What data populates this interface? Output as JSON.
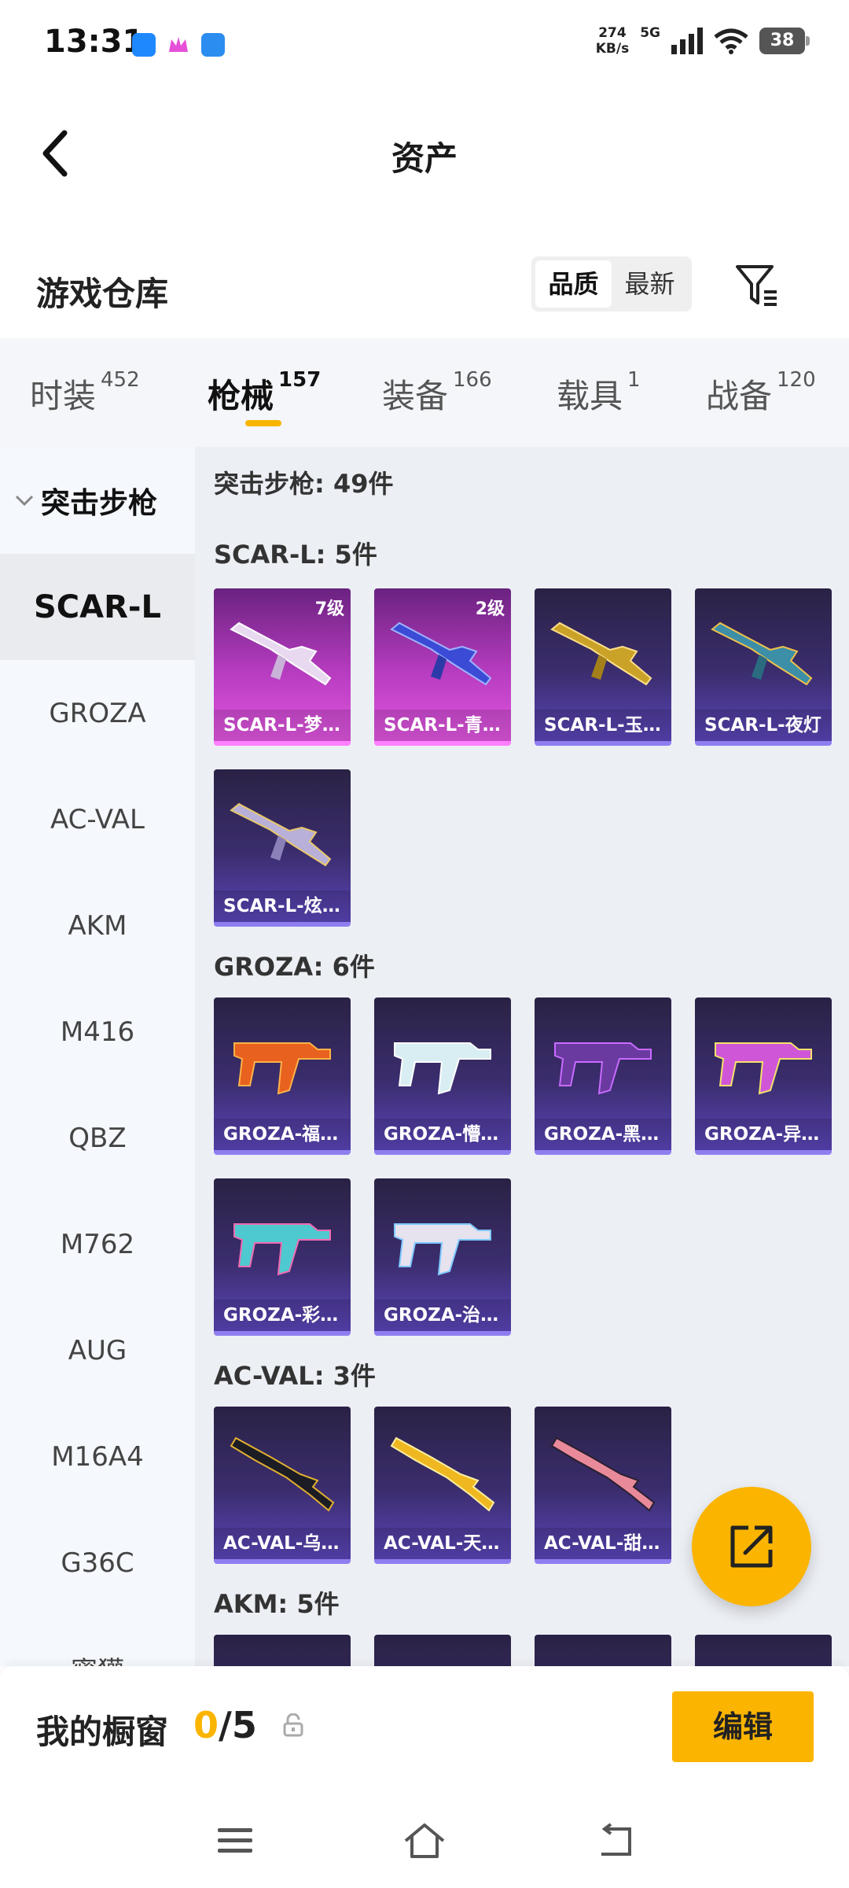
{
  "status_bar": {
    "time": "13:31",
    "net_speed_value": "274",
    "net_speed_unit": "KB/s",
    "network": "5G",
    "battery": "38"
  },
  "header": {
    "title": "资产"
  },
  "warehouse": {
    "title": "游戏仓库",
    "sort_options": [
      "品质",
      "最新"
    ],
    "sort_selected": "品质"
  },
  "tabs": [
    {
      "label": "时装",
      "count": "452"
    },
    {
      "label": "枪械",
      "count": "157"
    },
    {
      "label": "装备",
      "count": "166"
    },
    {
      "label": "载具",
      "count": "1"
    },
    {
      "label": "战备",
      "count": "120"
    }
  ],
  "sidebar": {
    "group": "突击步枪",
    "items": [
      "SCAR-L",
      "GROZA",
      "AC-VAL",
      "AKM",
      "M416",
      "QBZ",
      "M762",
      "AUG",
      "M16A4",
      "G36C",
      "蜜獾"
    ],
    "selected": "SCAR-L"
  },
  "content": {
    "heading": "突击步枪: 49件",
    "groups": [
      {
        "title": "SCAR-L: 5件",
        "items": [
          {
            "name": "SCAR-L-梦…",
            "level": "7级"
          },
          {
            "name": "SCAR-L-青…",
            "level": "2级"
          },
          {
            "name": "SCAR-L-玉…"
          },
          {
            "name": "SCAR-L-夜灯"
          },
          {
            "name": "SCAR-L-炫…"
          }
        ]
      },
      {
        "title": "GROZA: 6件",
        "items": [
          {
            "name": "GROZA-福…"
          },
          {
            "name": "GROZA-懵…"
          },
          {
            "name": "GROZA-黑…"
          },
          {
            "name": "GROZA-异…"
          },
          {
            "name": "GROZA-彩…"
          },
          {
            "name": "GROZA-治…"
          }
        ]
      },
      {
        "title": "AC-VAL: 3件",
        "items": [
          {
            "name": "AC-VAL-乌…"
          },
          {
            "name": "AC-VAL-天…"
          },
          {
            "name": "AC-VAL-甜…"
          }
        ]
      },
      {
        "title": "AKM: 5件"
      }
    ]
  },
  "bottom": {
    "window_label": "我的橱窗",
    "window_used": "0",
    "window_total": "/5",
    "edit_label": "编辑"
  },
  "colors": {
    "accent": "#fbb400",
    "card_purple": "#3b2d6e",
    "card_pink": "#b73cc0"
  }
}
